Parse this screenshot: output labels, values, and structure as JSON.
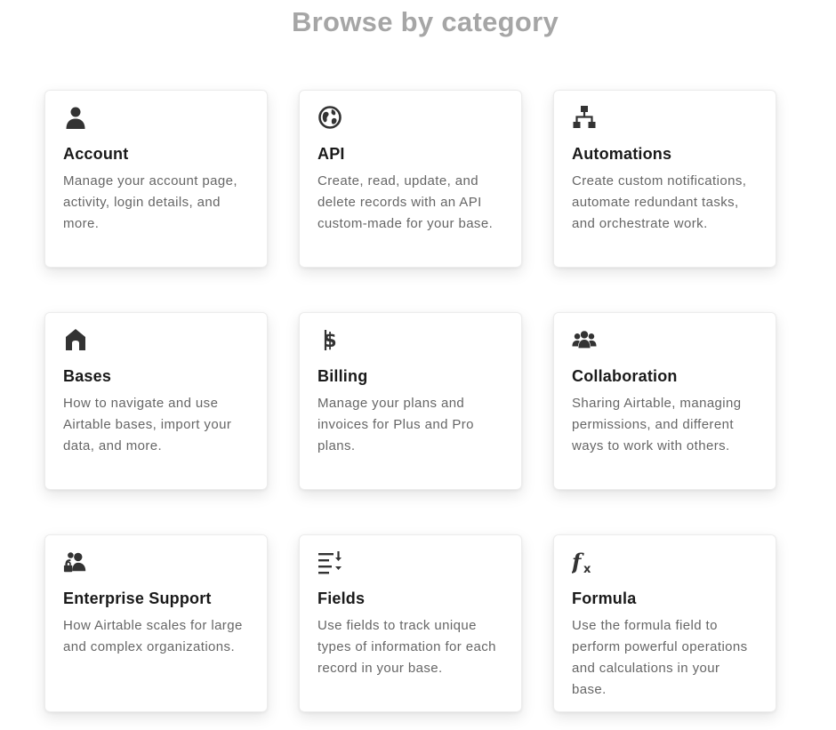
{
  "page": {
    "title": "Browse by category"
  },
  "categories": [
    {
      "icon": "user-icon",
      "title": "Account",
      "description": "Manage your account page, activity, login details, and more."
    },
    {
      "icon": "globe-icon",
      "title": "API",
      "description": "Create, read, update, and delete records with an API custom-made for your base."
    },
    {
      "icon": "flowchart-icon",
      "title": "Automations",
      "description": "Create custom notifications, automate redundant tasks, and orchestrate work."
    },
    {
      "icon": "home-icon",
      "title": "Bases",
      "description": "How to navigate and use Airtable bases, import your data, and more."
    },
    {
      "icon": "dollar-icon",
      "title": "Billing",
      "description": "Manage your plans and invoices for Plus and Pro plans."
    },
    {
      "icon": "users-icon",
      "title": "Collaboration",
      "description": "Sharing Airtable, managing permissions, and different ways to work with others."
    },
    {
      "icon": "user-lock-icon",
      "title": "Enterprise Support",
      "description": "How Airtable scales for large and complex organizations."
    },
    {
      "icon": "list-sort-icon",
      "title": "Fields",
      "description": "Use fields to track unique types of information for each record in your base."
    },
    {
      "icon": "function-icon",
      "title": "Formula",
      "description": "Use the formula field to perform powerful operations and calculations in your base."
    }
  ],
  "colors": {
    "title": "#a6a6a6",
    "card_title": "#1a1a1a",
    "card_desc": "#666666",
    "icon": "#333333"
  }
}
